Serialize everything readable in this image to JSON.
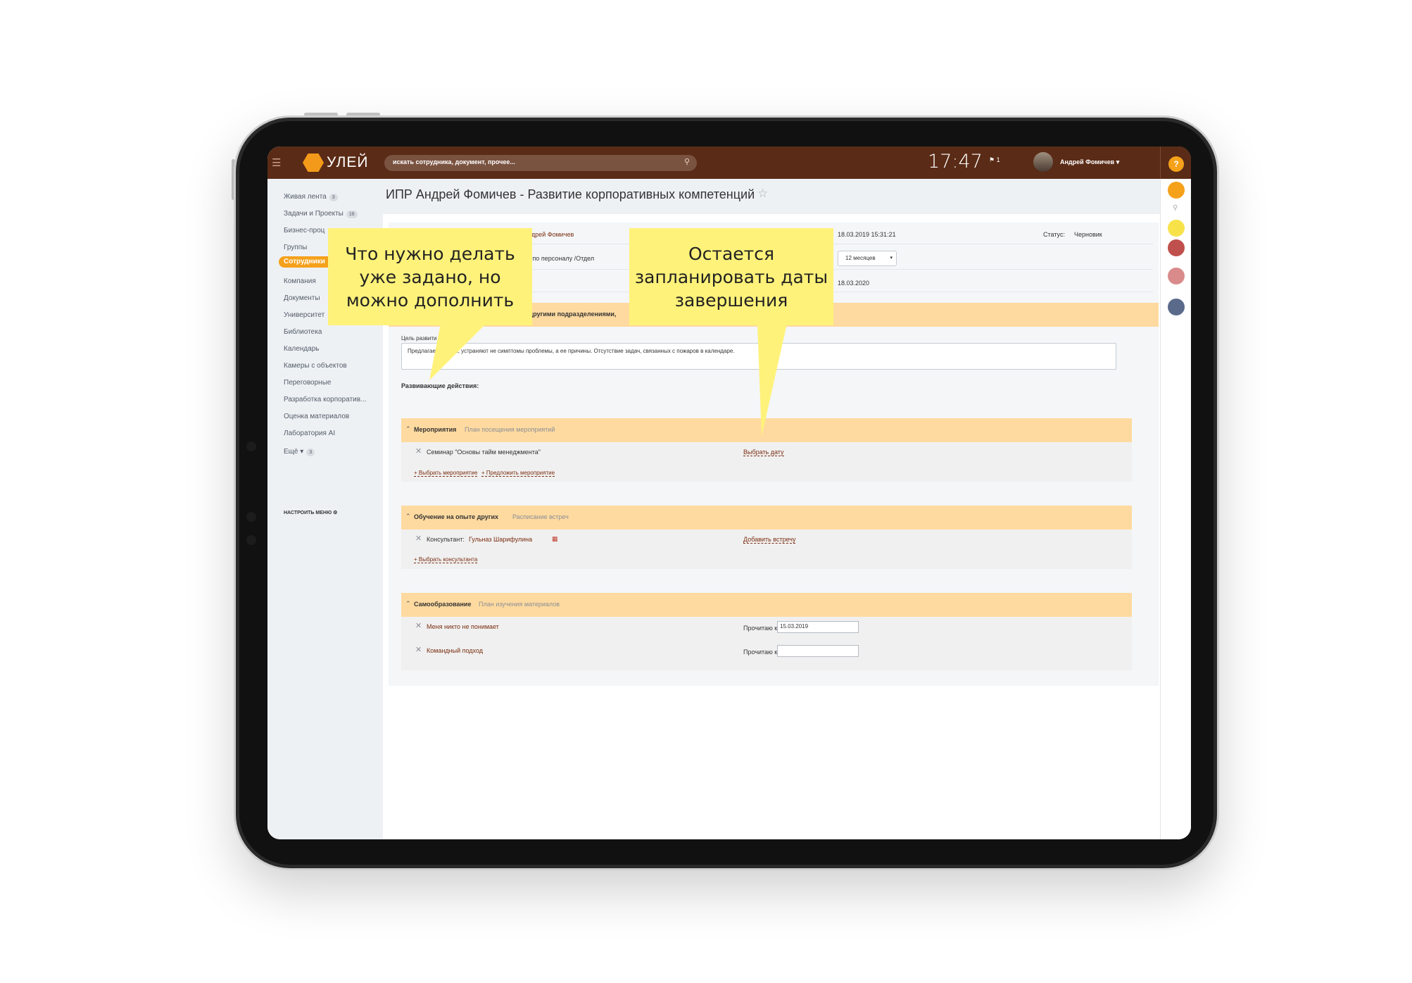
{
  "topbar": {
    "logo": "УЛЕЙ",
    "search_placeholder": "искать сотрудника, документ, прочее...",
    "clock": "17:47",
    "flag": "⚑ 1",
    "user": "Андрей Фомичев",
    "help": "?"
  },
  "sidebar": {
    "items": [
      {
        "label": "Живая лента",
        "count": "3"
      },
      {
        "label": "Задачи и Проекты",
        "count": "16"
      },
      {
        "label": "Бизнес-проц"
      },
      {
        "label": "Группы"
      },
      {
        "label": "Сотрудники"
      },
      {
        "label": "Компания"
      },
      {
        "label": "Документы"
      },
      {
        "label": "Университет"
      },
      {
        "label": "Библиотека"
      },
      {
        "label": "Календарь"
      },
      {
        "label": "Камеры с объектов"
      },
      {
        "label": "Переговорные"
      },
      {
        "label": "Разработка корпоратив..."
      },
      {
        "label": "Оценка материалов"
      },
      {
        "label": "Лаборатория AI"
      },
      {
        "label": "Ещё",
        "count": "3"
      }
    ],
    "settings": "НАСТРОИТЬ МЕНЮ"
  },
  "page": {
    "title": "ИПР Андрей Фомичев - Развитие корпоративных компетенций",
    "employee": "Андрей Фомичев",
    "position": "ер по персоналу /Отдел",
    "created": "18.03.2019 15:31:21",
    "status_label": "Статус:",
    "status_value": "Черновик",
    "period": "12 месяцев",
    "end_date": "18.03.2020",
    "warning": "с другими подразделениями,",
    "goal_label": "Цель развити",
    "goal_text": "Предлагаем      шения, устраняют не симптомы проблемы, а ее причины.  Отсутствие задач, связанных с                     пожаров в календаре.",
    "dev_label": "Развивающие действия:"
  },
  "sections": {
    "events": {
      "title": "Мероприятия",
      "subtitle": "План посещения мероприятий",
      "item": "Семинар \"Основы тайм менеджмента\"",
      "action": "Выбрать дату",
      "add1": "+ Выбрать мероприятие",
      "add2": "+ Предложить мероприятие"
    },
    "learning": {
      "title": "Обучение на опыте других",
      "subtitle": "Расписание встреч",
      "item_label": "Консультант:",
      "item_value": "Гульназ Шарифулина",
      "action": "Добавить встречу",
      "add1": "+ Выбрать консультанта"
    },
    "self": {
      "title": "Самообразование",
      "subtitle": "План изучения материалов",
      "item1": "Меня никто не понимает",
      "item2": "Командный подход",
      "read_label": "Прочитаю к",
      "read_date1": "15.03.2019",
      "read_date2": ""
    }
  },
  "callouts": {
    "left": "Что нужно делать уже задано, но можно дополнить",
    "right": "Остается запланировать даты завершения"
  },
  "colors": {
    "topbar": "#5a2b16",
    "accent": "#f5a11a",
    "section": "#ffdaa0",
    "callout": "#fff27a"
  }
}
